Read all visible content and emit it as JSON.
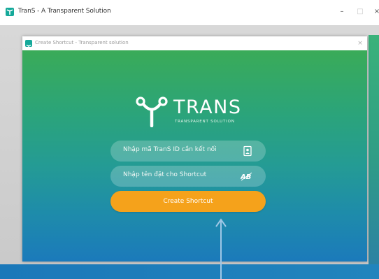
{
  "window": {
    "title": "TranS - A Transparent Solution",
    "minimize": "–",
    "maximize": "□",
    "close": "×"
  },
  "dialog": {
    "title": "Create Shortcut - Transparent solution",
    "close": "×"
  },
  "logo": {
    "name": "TRANS",
    "tagline": "TRANSPARENT SOLUTION"
  },
  "form": {
    "id_placeholder": "Nhập mã TranS ID cần kết nối",
    "id_icon": "contact-card-icon",
    "name_placeholder": "Nhập tên đặt cho Shortcut",
    "name_icon": "text-abc-icon",
    "submit_label": "Create Shortcut"
  },
  "colors": {
    "accent": "#f5a21b",
    "gradient_top": "#3aab58",
    "gradient_bottom": "#1b7abb",
    "brand": "#15a99a"
  }
}
